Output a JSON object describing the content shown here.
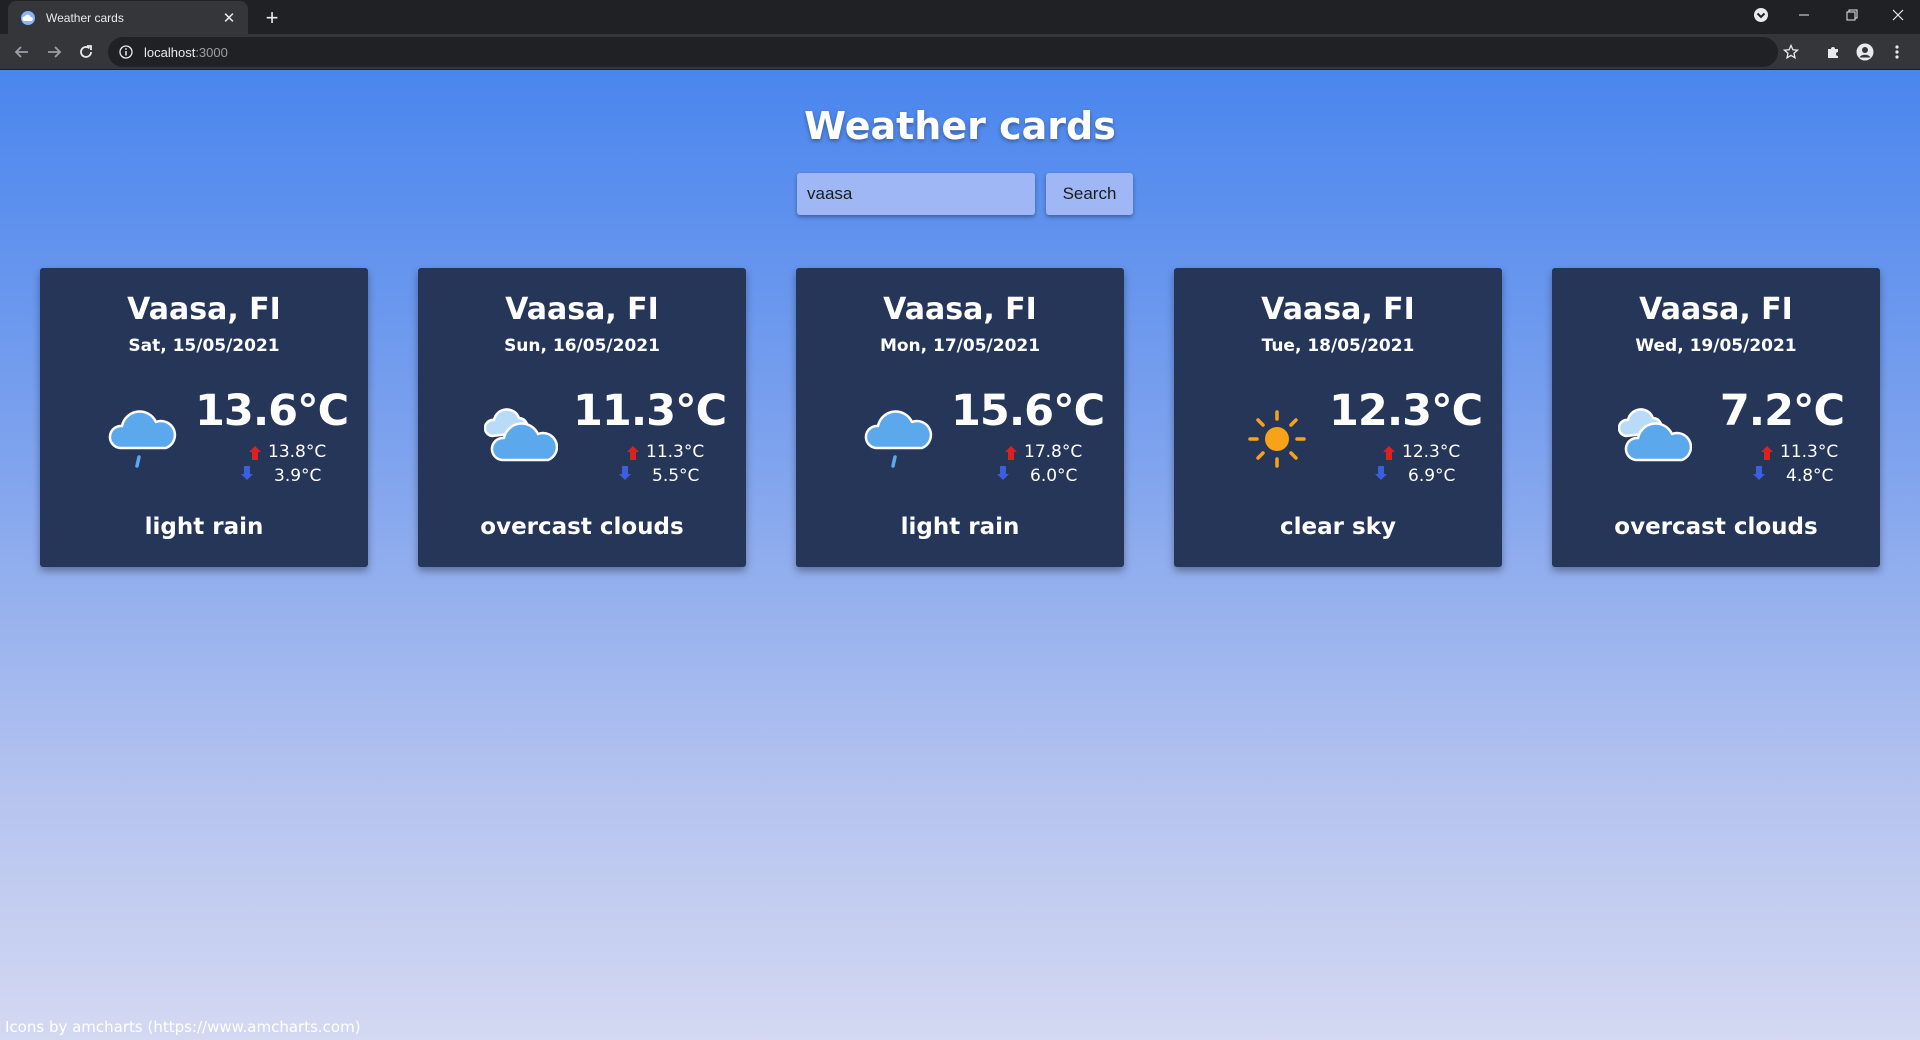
{
  "browser": {
    "tab_title": "Weather cards",
    "new_tab_symbol": "+",
    "url_host": "localhost",
    "url_port": ":3000"
  },
  "colors": {
    "card_background": "#263659",
    "arrow_up": "#e0201f",
    "arrow_down": "#3c5fe0",
    "sun": "#f8a21a",
    "cloud": "#5ba8ec"
  },
  "page": {
    "title": "Weather cards",
    "footer_credit": "Icons by amcharts (https://www.amcharts.com)"
  },
  "search": {
    "value": "vaasa",
    "button_label": "Search"
  },
  "cards": [
    {
      "city": "Vaasa, FI",
      "date": "Sat, 15/05/2021",
      "temp": "13.6°C",
      "max": "13.8°C",
      "min": "3.9°C",
      "description": "light rain",
      "icon": "rain-icon"
    },
    {
      "city": "Vaasa, FI",
      "date": "Sun, 16/05/2021",
      "temp": "11.3°C",
      "max": "11.3°C",
      "min": "5.5°C",
      "description": "overcast clouds",
      "icon": "cloudy-icon"
    },
    {
      "city": "Vaasa, FI",
      "date": "Mon, 17/05/2021",
      "temp": "15.6°C",
      "max": "17.8°C",
      "min": "6.0°C",
      "description": "light rain",
      "icon": "rain-icon"
    },
    {
      "city": "Vaasa, FI",
      "date": "Tue, 18/05/2021",
      "temp": "12.3°C",
      "max": "12.3°C",
      "min": "6.9°C",
      "description": "clear sky",
      "icon": "sun-icon"
    },
    {
      "city": "Vaasa, FI",
      "date": "Wed, 19/05/2021",
      "temp": "7.2°C",
      "max": "11.3°C",
      "min": "4.8°C",
      "description": "overcast clouds",
      "icon": "cloudy-icon"
    }
  ]
}
